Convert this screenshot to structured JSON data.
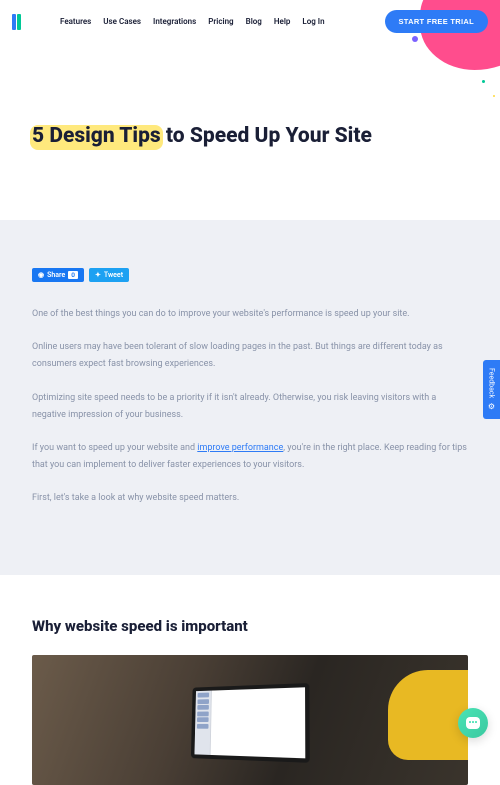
{
  "nav": {
    "items": [
      "Features",
      "Use Cases",
      "Integrations",
      "Pricing",
      "Blog",
      "Help",
      "Log In"
    ],
    "cta": "START FREE TRIAL"
  },
  "hero": {
    "title_highlight": "5 Design Tips",
    "title_rest": " to Speed Up Your Site"
  },
  "share": {
    "fb_label": "Share",
    "fb_count": "0",
    "tw_label": "Tweet"
  },
  "article": {
    "p1": "One of the best things you can do to improve your website's performance is speed up your site.",
    "p2": "Online users may have been tolerant of slow loading pages in the past. But things are different today as consumers expect fast browsing experiences.",
    "p3": "Optimizing site speed needs to be a priority if it isn't already. Otherwise, you risk leaving visitors with a negative impression of your business.",
    "p4_a": "If you want to speed up your website and ",
    "p4_link": "improve performance",
    "p4_b": ", you're in the right place. Keep reading for tips that you can implement to deliver faster experiences to your visitors.",
    "p5": "First, let's take a look at why website speed matters."
  },
  "section2_heading": "Why website speed is important",
  "feedback_label": "Feedback"
}
